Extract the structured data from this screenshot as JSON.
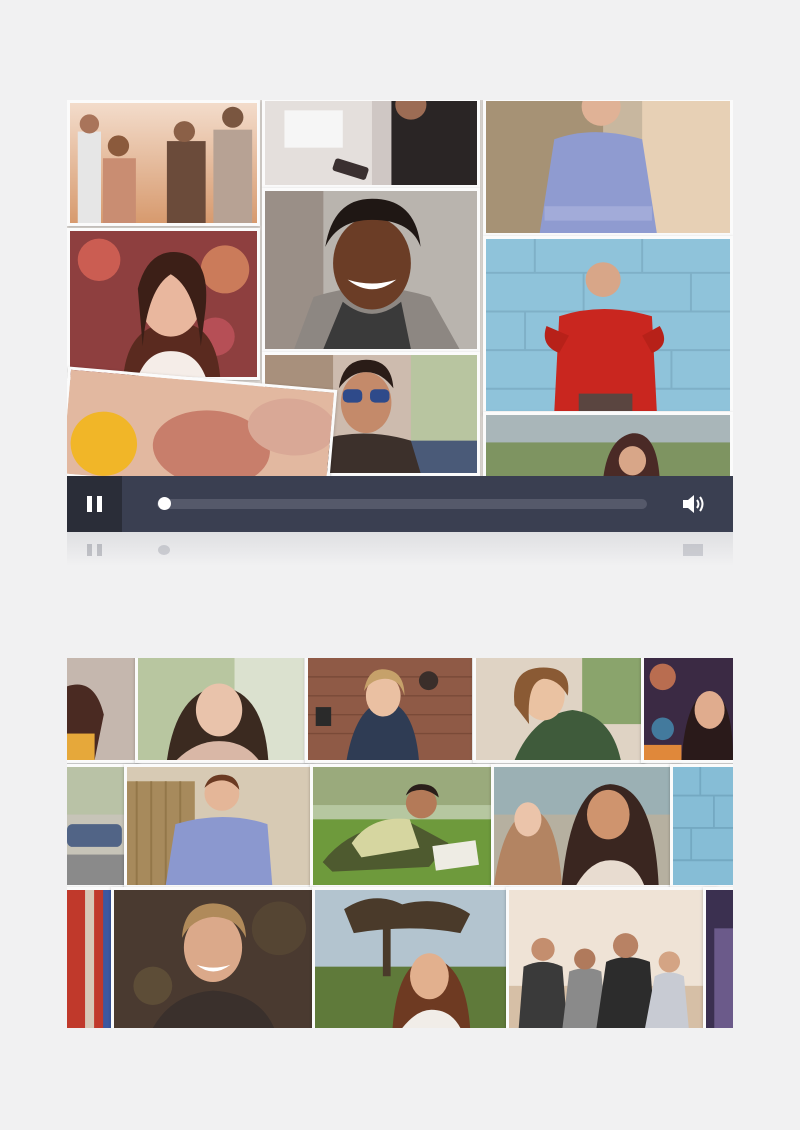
{
  "player": {
    "state": "playing",
    "progress": 0.0,
    "controls": {
      "play_pause_icon": "pause-icon",
      "volume_icon": "volume-icon"
    },
    "colors": {
      "control_bar": "#3a3f51",
      "play_button_bg": "#2a2d38",
      "track": "#55596a",
      "knob": "#ffffff"
    }
  },
  "video_frame": {
    "photos": [
      "group-of-friends-sunset",
      "man-with-phone",
      "man-plaid-shirt-arms-crossed",
      "woman-smiling-city-lights",
      "woman-curly-hair-laughing",
      "man-red-sweater-cheering",
      "man-sunglasses-smiling",
      "blurred-close-up",
      "woman-outdoors-field"
    ]
  },
  "gallery": {
    "photos": [
      "woman-partial-left",
      "asian-woman-smiling",
      "woman-brick-wall-camera",
      "woman-laughing-green-top",
      "woman-neon-lights",
      "street-cars",
      "man-plaid-shirt-wall",
      "man-writing-on-grass",
      "two-women-laughing",
      "blue-brick-wall",
      "red-door",
      "young-man-smiling",
      "woman-tree-sunlight",
      "group-of-men-friends",
      "partial-right-portrait"
    ]
  }
}
